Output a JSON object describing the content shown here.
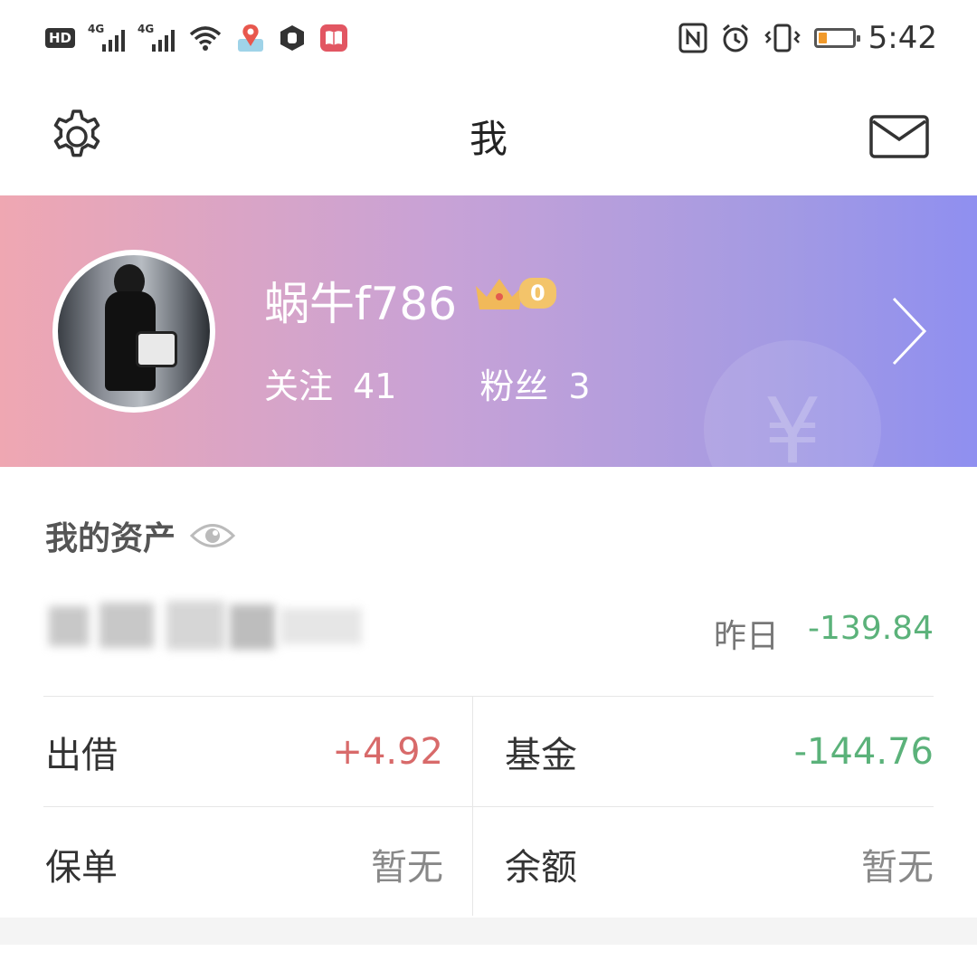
{
  "status_bar": {
    "hd_badge": "HD",
    "signal1_gen": "4G",
    "signal2_gen": "4G",
    "time": "5:42",
    "battery_level_fraction": 0.22,
    "left_icons": [
      "hd-icon",
      "signal-icon",
      "signal-icon",
      "wifi-icon",
      "maps-icon",
      "hexagon-hand-icon",
      "book-app-icon"
    ],
    "right_icons": [
      "nfc-icon",
      "alarm-icon",
      "vibrate-icon",
      "battery-icon"
    ]
  },
  "header": {
    "title": "我",
    "left_icon": "gear-icon",
    "right_icon": "mail-icon"
  },
  "profile": {
    "username": "蜗牛f786",
    "level_badge": "0",
    "following_label": "关注",
    "following_count": "41",
    "fans_label": "粉丝",
    "fans_count": "3",
    "coin_symbol": "¥",
    "gradient_colors": [
      "#efa7b2",
      "#c8a2d6",
      "#a39ae3",
      "#8f8ff0"
    ]
  },
  "assets": {
    "title": "我的资产",
    "yesterday_label": "昨日",
    "yesterday_value": "-139.84",
    "items": [
      {
        "label": "出借",
        "value": "+4.92"
      },
      {
        "label": "基金",
        "value": "-144.76"
      },
      {
        "label": "保单",
        "value": "暂无"
      },
      {
        "label": "余额",
        "value": "暂无"
      }
    ],
    "colors": {
      "negative": "#5bb27a",
      "positive": "#d86a6a"
    }
  }
}
